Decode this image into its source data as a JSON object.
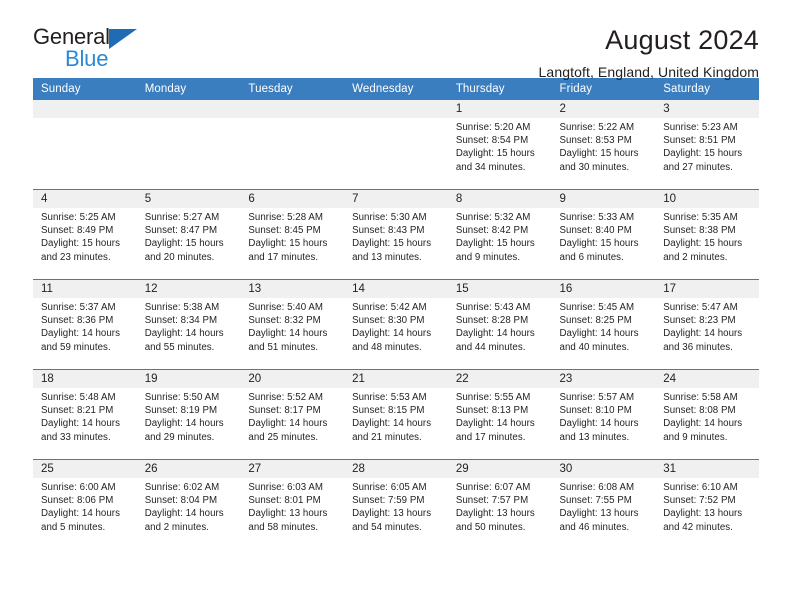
{
  "brand": {
    "name_part1": "General",
    "name_part2": "Blue",
    "accent_color": "#2b88d8",
    "triangle_color": "#1f6cb4"
  },
  "header": {
    "title": "August 2024",
    "location": "Langtoft, England, United Kingdom"
  },
  "calendar": {
    "header_color": "#3b7ebf",
    "daynum_bg": "#f0f0f0",
    "weekday_headers": [
      "Sunday",
      "Monday",
      "Tuesday",
      "Wednesday",
      "Thursday",
      "Friday",
      "Saturday"
    ],
    "weeks": [
      [
        {
          "day": "",
          "empty": true,
          "sunrise": "",
          "sunset": "",
          "daylight1": "",
          "daylight2": ""
        },
        {
          "day": "",
          "empty": true,
          "sunrise": "",
          "sunset": "",
          "daylight1": "",
          "daylight2": ""
        },
        {
          "day": "",
          "empty": true,
          "sunrise": "",
          "sunset": "",
          "daylight1": "",
          "daylight2": ""
        },
        {
          "day": "",
          "empty": true,
          "sunrise": "",
          "sunset": "",
          "daylight1": "",
          "daylight2": ""
        },
        {
          "day": "1",
          "sunrise": "Sunrise: 5:20 AM",
          "sunset": "Sunset: 8:54 PM",
          "daylight1": "Daylight: 15 hours",
          "daylight2": "and 34 minutes."
        },
        {
          "day": "2",
          "sunrise": "Sunrise: 5:22 AM",
          "sunset": "Sunset: 8:53 PM",
          "daylight1": "Daylight: 15 hours",
          "daylight2": "and 30 minutes."
        },
        {
          "day": "3",
          "sunrise": "Sunrise: 5:23 AM",
          "sunset": "Sunset: 8:51 PM",
          "daylight1": "Daylight: 15 hours",
          "daylight2": "and 27 minutes."
        }
      ],
      [
        {
          "day": "4",
          "sunrise": "Sunrise: 5:25 AM",
          "sunset": "Sunset: 8:49 PM",
          "daylight1": "Daylight: 15 hours",
          "daylight2": "and 23 minutes."
        },
        {
          "day": "5",
          "sunrise": "Sunrise: 5:27 AM",
          "sunset": "Sunset: 8:47 PM",
          "daylight1": "Daylight: 15 hours",
          "daylight2": "and 20 minutes."
        },
        {
          "day": "6",
          "sunrise": "Sunrise: 5:28 AM",
          "sunset": "Sunset: 8:45 PM",
          "daylight1": "Daylight: 15 hours",
          "daylight2": "and 17 minutes."
        },
        {
          "day": "7",
          "sunrise": "Sunrise: 5:30 AM",
          "sunset": "Sunset: 8:43 PM",
          "daylight1": "Daylight: 15 hours",
          "daylight2": "and 13 minutes."
        },
        {
          "day": "8",
          "sunrise": "Sunrise: 5:32 AM",
          "sunset": "Sunset: 8:42 PM",
          "daylight1": "Daylight: 15 hours",
          "daylight2": "and 9 minutes."
        },
        {
          "day": "9",
          "sunrise": "Sunrise: 5:33 AM",
          "sunset": "Sunset: 8:40 PM",
          "daylight1": "Daylight: 15 hours",
          "daylight2": "and 6 minutes."
        },
        {
          "day": "10",
          "sunrise": "Sunrise: 5:35 AM",
          "sunset": "Sunset: 8:38 PM",
          "daylight1": "Daylight: 15 hours",
          "daylight2": "and 2 minutes."
        }
      ],
      [
        {
          "day": "11",
          "sunrise": "Sunrise: 5:37 AM",
          "sunset": "Sunset: 8:36 PM",
          "daylight1": "Daylight: 14 hours",
          "daylight2": "and 59 minutes."
        },
        {
          "day": "12",
          "sunrise": "Sunrise: 5:38 AM",
          "sunset": "Sunset: 8:34 PM",
          "daylight1": "Daylight: 14 hours",
          "daylight2": "and 55 minutes."
        },
        {
          "day": "13",
          "sunrise": "Sunrise: 5:40 AM",
          "sunset": "Sunset: 8:32 PM",
          "daylight1": "Daylight: 14 hours",
          "daylight2": "and 51 minutes."
        },
        {
          "day": "14",
          "sunrise": "Sunrise: 5:42 AM",
          "sunset": "Sunset: 8:30 PM",
          "daylight1": "Daylight: 14 hours",
          "daylight2": "and 48 minutes."
        },
        {
          "day": "15",
          "sunrise": "Sunrise: 5:43 AM",
          "sunset": "Sunset: 8:28 PM",
          "daylight1": "Daylight: 14 hours",
          "daylight2": "and 44 minutes."
        },
        {
          "day": "16",
          "sunrise": "Sunrise: 5:45 AM",
          "sunset": "Sunset: 8:25 PM",
          "daylight1": "Daylight: 14 hours",
          "daylight2": "and 40 minutes."
        },
        {
          "day": "17",
          "sunrise": "Sunrise: 5:47 AM",
          "sunset": "Sunset: 8:23 PM",
          "daylight1": "Daylight: 14 hours",
          "daylight2": "and 36 minutes."
        }
      ],
      [
        {
          "day": "18",
          "sunrise": "Sunrise: 5:48 AM",
          "sunset": "Sunset: 8:21 PM",
          "daylight1": "Daylight: 14 hours",
          "daylight2": "and 33 minutes."
        },
        {
          "day": "19",
          "sunrise": "Sunrise: 5:50 AM",
          "sunset": "Sunset: 8:19 PM",
          "daylight1": "Daylight: 14 hours",
          "daylight2": "and 29 minutes."
        },
        {
          "day": "20",
          "sunrise": "Sunrise: 5:52 AM",
          "sunset": "Sunset: 8:17 PM",
          "daylight1": "Daylight: 14 hours",
          "daylight2": "and 25 minutes."
        },
        {
          "day": "21",
          "sunrise": "Sunrise: 5:53 AM",
          "sunset": "Sunset: 8:15 PM",
          "daylight1": "Daylight: 14 hours",
          "daylight2": "and 21 minutes."
        },
        {
          "day": "22",
          "sunrise": "Sunrise: 5:55 AM",
          "sunset": "Sunset: 8:13 PM",
          "daylight1": "Daylight: 14 hours",
          "daylight2": "and 17 minutes."
        },
        {
          "day": "23",
          "sunrise": "Sunrise: 5:57 AM",
          "sunset": "Sunset: 8:10 PM",
          "daylight1": "Daylight: 14 hours",
          "daylight2": "and 13 minutes."
        },
        {
          "day": "24",
          "sunrise": "Sunrise: 5:58 AM",
          "sunset": "Sunset: 8:08 PM",
          "daylight1": "Daylight: 14 hours",
          "daylight2": "and 9 minutes."
        }
      ],
      [
        {
          "day": "25",
          "sunrise": "Sunrise: 6:00 AM",
          "sunset": "Sunset: 8:06 PM",
          "daylight1": "Daylight: 14 hours",
          "daylight2": "and 5 minutes."
        },
        {
          "day": "26",
          "sunrise": "Sunrise: 6:02 AM",
          "sunset": "Sunset: 8:04 PM",
          "daylight1": "Daylight: 14 hours",
          "daylight2": "and 2 minutes."
        },
        {
          "day": "27",
          "sunrise": "Sunrise: 6:03 AM",
          "sunset": "Sunset: 8:01 PM",
          "daylight1": "Daylight: 13 hours",
          "daylight2": "and 58 minutes."
        },
        {
          "day": "28",
          "sunrise": "Sunrise: 6:05 AM",
          "sunset": "Sunset: 7:59 PM",
          "daylight1": "Daylight: 13 hours",
          "daylight2": "and 54 minutes."
        },
        {
          "day": "29",
          "sunrise": "Sunrise: 6:07 AM",
          "sunset": "Sunset: 7:57 PM",
          "daylight1": "Daylight: 13 hours",
          "daylight2": "and 50 minutes."
        },
        {
          "day": "30",
          "sunrise": "Sunrise: 6:08 AM",
          "sunset": "Sunset: 7:55 PM",
          "daylight1": "Daylight: 13 hours",
          "daylight2": "and 46 minutes."
        },
        {
          "day": "31",
          "sunrise": "Sunrise: 6:10 AM",
          "sunset": "Sunset: 7:52 PM",
          "daylight1": "Daylight: 13 hours",
          "daylight2": "and 42 minutes."
        }
      ]
    ]
  }
}
